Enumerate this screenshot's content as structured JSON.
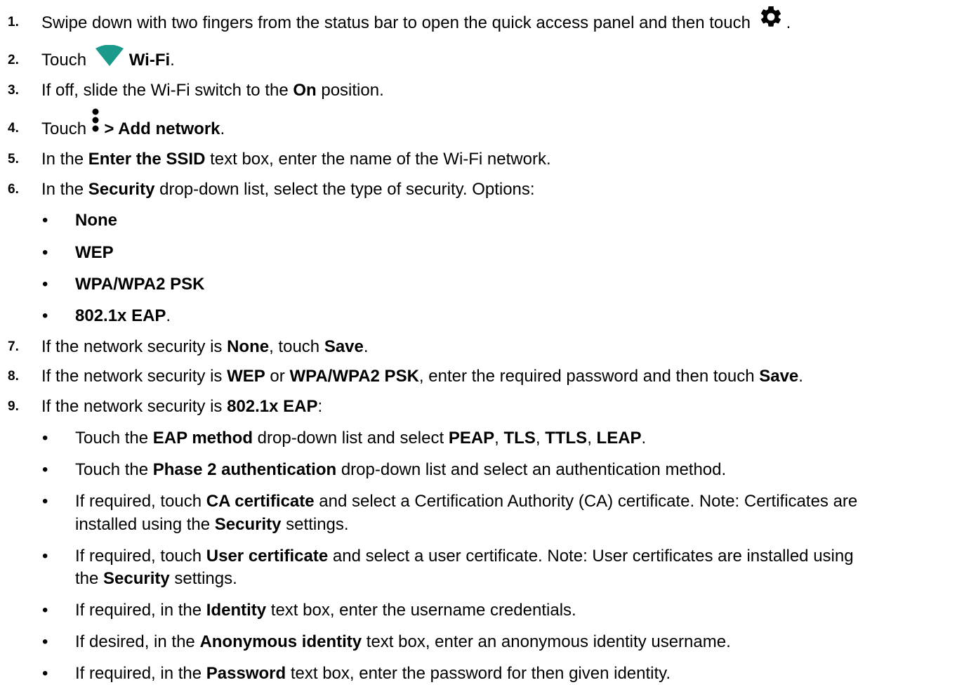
{
  "steps": [
    {
      "num": "1.",
      "a": "Swipe down with two fingers from the status bar to open the quick access panel and then touch ",
      "icon": "gear-icon",
      "b": "."
    },
    {
      "num": "2.",
      "a": "Touch ",
      "icon": "wifi-icon",
      "bold": "Wi-Fi",
      "b": "."
    },
    {
      "num": "3.",
      "a": "If off, slide the Wi-Fi switch to the ",
      "bold": "On",
      "b": " position."
    },
    {
      "num": "4.",
      "a": "Touch ",
      "icon": "more-vertical-icon",
      "bold": " > Add network",
      "b": "."
    },
    {
      "num": "5.",
      "a": "In the ",
      "bold": "Enter the SSID",
      "b": " text box, enter the name of the Wi-Fi network."
    },
    {
      "num": "6.",
      "a": "In the ",
      "bold": "Security",
      "b": " drop-down list, select the type of security. Options:"
    },
    {
      "num": "7.",
      "a": "If the network security is ",
      "bold": "None",
      "b": ", touch ",
      "bold2": "Save",
      "c": "."
    },
    {
      "num": "8.",
      "a": "If the network security is ",
      "bold": "WEP",
      "b": " or ",
      "bold2": "WPA/WPA2 PSK",
      "c": ", enter the required password and then touch ",
      "bold3": "Save",
      "d": "."
    },
    {
      "num": "9.",
      "a": "If the network security is ",
      "bold": "802.1x EAP",
      "b": ":"
    }
  ],
  "security_options": [
    "None",
    "WEP",
    "WPA/WPA2 PSK",
    "802.1x EAP"
  ],
  "security_option_end": ".",
  "eap_bullets": {
    "b1": {
      "a": "Touch the ",
      "bold": "EAP method",
      "b": " drop-down list and select ",
      "bold2": "PEAP",
      "c": ", ",
      "bold3": "TLS",
      "d": ", ",
      "bold4": "TTLS",
      "e": ", ",
      "bold5": "LEAP",
      "f": "."
    },
    "b2": {
      "a": "Touch the ",
      "bold": "Phase 2 authentication",
      "b": " drop-down list and select an authentication method."
    },
    "b3": {
      "a": "If required, touch ",
      "bold": "CA certificate",
      "b": " and select a Certification Authority (CA) certificate. Note: Certificates are",
      "line2a": "installed using the ",
      "line2bold": "Security",
      "line2b": " settings."
    },
    "b4": {
      "a": "If required, touch ",
      "bold": "User certificate",
      "b": " and select a user certificate. Note: User certificates are installed using",
      "line2a": "the ",
      "line2bold": "Security",
      "line2b": " settings."
    },
    "b5": {
      "a": "If required, in the ",
      "bold": "Identity",
      "b": " text box, enter the username credentials."
    },
    "b6": {
      "a": "If desired, in the ",
      "bold": "Anonymous identity",
      "b": " text box, enter an anonymous identity username."
    },
    "b7": {
      "a": "If required, in the ",
      "bold": "Password",
      "b": " text box, enter the password for then given identity."
    }
  },
  "bullet_char": "•",
  "colors": {
    "wifi_icon": "#1a9a8a",
    "text": "#000000"
  }
}
